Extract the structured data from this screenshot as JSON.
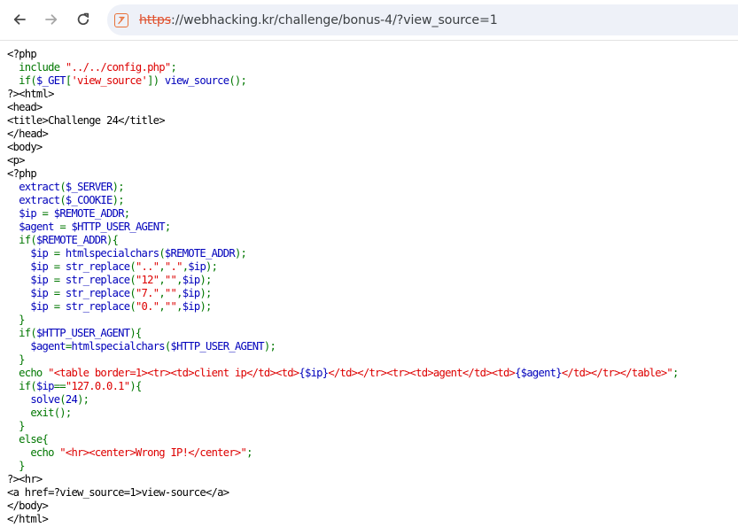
{
  "browser": {
    "url": {
      "scheme": "https",
      "rest": "://webhacking.kr/challenge/bonus-4/?view_source=1"
    }
  },
  "colors": {
    "php_keyword": "#007700",
    "php_string": "#dd0000",
    "php_default": "#0000bb",
    "html": "#000000",
    "insecure_scheme": "#e0502d"
  },
  "source_lines": [
    [
      [
        "h",
        "<?php"
      ]
    ],
    [
      [
        "k",
        "  include "
      ],
      [
        "s",
        "\"../../config.php\""
      ],
      [
        "k",
        ";"
      ]
    ],
    [
      [
        "k",
        "  if("
      ],
      [
        "v",
        "$_GET"
      ],
      [
        "k",
        "["
      ],
      [
        "s",
        "'view_source'"
      ],
      [
        "k",
        "]) "
      ],
      [
        "v",
        "view_source"
      ],
      [
        "k",
        "();"
      ]
    ],
    [
      [
        "h",
        "?><html>"
      ]
    ],
    [
      [
        "h",
        "<head>"
      ]
    ],
    [
      [
        "h",
        "<title>Challenge 24</title>"
      ]
    ],
    [
      [
        "h",
        "</head>"
      ]
    ],
    [
      [
        "h",
        "<body>"
      ]
    ],
    [
      [
        "h",
        "<p>"
      ]
    ],
    [
      [
        "h",
        "<?php"
      ]
    ],
    [
      [
        "k",
        "  "
      ],
      [
        "v",
        "extract"
      ],
      [
        "k",
        "("
      ],
      [
        "v",
        "$_SERVER"
      ],
      [
        "k",
        ");"
      ]
    ],
    [
      [
        "k",
        "  "
      ],
      [
        "v",
        "extract"
      ],
      [
        "k",
        "("
      ],
      [
        "v",
        "$_COOKIE"
      ],
      [
        "k",
        ");"
      ]
    ],
    [
      [
        "k",
        "  "
      ],
      [
        "v",
        "$ip "
      ],
      [
        "k",
        "= "
      ],
      [
        "v",
        "$REMOTE_ADDR"
      ],
      [
        "k",
        ";"
      ]
    ],
    [
      [
        "k",
        "  "
      ],
      [
        "v",
        "$agent "
      ],
      [
        "k",
        "= "
      ],
      [
        "v",
        "$HTTP_USER_AGENT"
      ],
      [
        "k",
        ";"
      ]
    ],
    [
      [
        "k",
        "  if("
      ],
      [
        "v",
        "$REMOTE_ADDR"
      ],
      [
        "k",
        "){"
      ]
    ],
    [
      [
        "k",
        "    "
      ],
      [
        "v",
        "$ip "
      ],
      [
        "k",
        "= "
      ],
      [
        "v",
        "htmlspecialchars"
      ],
      [
        "k",
        "("
      ],
      [
        "v",
        "$REMOTE_ADDR"
      ],
      [
        "k",
        ");"
      ]
    ],
    [
      [
        "k",
        "    "
      ],
      [
        "v",
        "$ip "
      ],
      [
        "k",
        "= "
      ],
      [
        "v",
        "str_replace"
      ],
      [
        "k",
        "("
      ],
      [
        "s",
        "\"..\""
      ],
      [
        "k",
        ","
      ],
      [
        "s",
        "\".\""
      ],
      [
        "k",
        ","
      ],
      [
        "v",
        "$ip"
      ],
      [
        "k",
        ");"
      ]
    ],
    [
      [
        "k",
        "    "
      ],
      [
        "v",
        "$ip "
      ],
      [
        "k",
        "= "
      ],
      [
        "v",
        "str_replace"
      ],
      [
        "k",
        "("
      ],
      [
        "s",
        "\"12\""
      ],
      [
        "k",
        ","
      ],
      [
        "s",
        "\"\""
      ],
      [
        "k",
        ","
      ],
      [
        "v",
        "$ip"
      ],
      [
        "k",
        ");"
      ]
    ],
    [
      [
        "k",
        "    "
      ],
      [
        "v",
        "$ip "
      ],
      [
        "k",
        "= "
      ],
      [
        "v",
        "str_replace"
      ],
      [
        "k",
        "("
      ],
      [
        "s",
        "\"7.\""
      ],
      [
        "k",
        ","
      ],
      [
        "s",
        "\"\""
      ],
      [
        "k",
        ","
      ],
      [
        "v",
        "$ip"
      ],
      [
        "k",
        ");"
      ]
    ],
    [
      [
        "k",
        "    "
      ],
      [
        "v",
        "$ip "
      ],
      [
        "k",
        "= "
      ],
      [
        "v",
        "str_replace"
      ],
      [
        "k",
        "("
      ],
      [
        "s",
        "\"0.\""
      ],
      [
        "k",
        ","
      ],
      [
        "s",
        "\"\""
      ],
      [
        "k",
        ","
      ],
      [
        "v",
        "$ip"
      ],
      [
        "k",
        ");"
      ]
    ],
    [
      [
        "k",
        "  }"
      ]
    ],
    [
      [
        "k",
        "  if("
      ],
      [
        "v",
        "$HTTP_USER_AGENT"
      ],
      [
        "k",
        "){"
      ]
    ],
    [
      [
        "k",
        "    "
      ],
      [
        "v",
        "$agent"
      ],
      [
        "k",
        "="
      ],
      [
        "v",
        "htmlspecialchars"
      ],
      [
        "k",
        "("
      ],
      [
        "v",
        "$HTTP_USER_AGENT"
      ],
      [
        "k",
        ");"
      ]
    ],
    [
      [
        "k",
        "  }"
      ]
    ],
    [
      [
        "k",
        "  echo "
      ],
      [
        "s",
        "\"<table border=1><tr><td>client ip</td><td>"
      ],
      [
        "v",
        "{$ip}"
      ],
      [
        "s",
        "</td></tr><tr><td>agent</td><td>"
      ],
      [
        "v",
        "{$agent}"
      ],
      [
        "s",
        "</td></tr></table>\""
      ],
      [
        "k",
        ";"
      ]
    ],
    [
      [
        "k",
        "  if("
      ],
      [
        "v",
        "$ip"
      ],
      [
        "k",
        "=="
      ],
      [
        "s",
        "\"127.0.0.1\""
      ],
      [
        "k",
        "){"
      ]
    ],
    [
      [
        "k",
        "    "
      ],
      [
        "v",
        "solve"
      ],
      [
        "k",
        "("
      ],
      [
        "v",
        "24"
      ],
      [
        "k",
        ");"
      ]
    ],
    [
      [
        "k",
        "    exit();"
      ]
    ],
    [
      [
        "k",
        "  }"
      ]
    ],
    [
      [
        "k",
        "  else{"
      ]
    ],
    [
      [
        "k",
        "    echo "
      ],
      [
        "s",
        "\"<hr><center>Wrong IP!</center>\""
      ],
      [
        "k",
        ";"
      ]
    ],
    [
      [
        "k",
        "  }"
      ]
    ],
    [
      [
        "h",
        "?><hr>"
      ]
    ],
    [
      [
        "h",
        "<a href=?view_source=1>view-source</a>"
      ]
    ],
    [
      [
        "h",
        "</body>"
      ]
    ],
    [
      [
        "h",
        "</html>"
      ]
    ]
  ]
}
